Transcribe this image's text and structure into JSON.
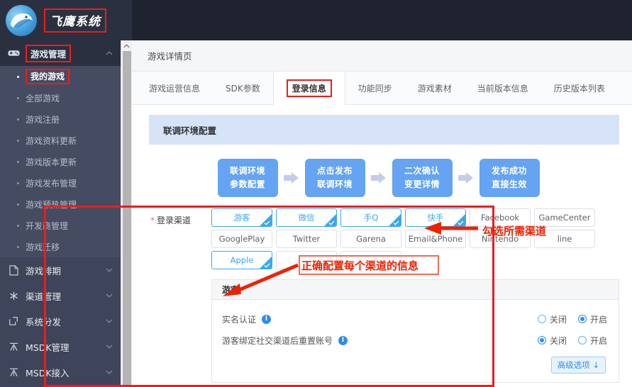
{
  "brand": {
    "name": "飞鹰系统",
    "logo_icon": "eagle-logo-icon"
  },
  "sidebar": {
    "groups": [
      {
        "label": "游戏管理",
        "icon": "gamepad-icon",
        "expanded": true,
        "active": true,
        "items": [
          {
            "label": "我的游戏",
            "active": true
          },
          {
            "label": "全部游戏",
            "active": false
          },
          {
            "label": "游戏注册",
            "active": false
          },
          {
            "label": "游戏资料更新",
            "active": false
          },
          {
            "label": "游戏版本更新",
            "active": false
          },
          {
            "label": "游戏发布管理",
            "active": false
          },
          {
            "label": "游戏预热管理",
            "active": false
          },
          {
            "label": "开发商管理",
            "active": false
          },
          {
            "label": "游戏迁移",
            "active": false
          }
        ]
      },
      {
        "label": "游戏排期",
        "icon": "document-icon",
        "expanded": false,
        "active": false,
        "items": []
      },
      {
        "label": "渠道管理",
        "icon": "asterisk-icon",
        "expanded": false,
        "active": false,
        "items": []
      },
      {
        "label": "系统分发",
        "icon": "external-link-icon",
        "expanded": false,
        "active": false,
        "items": []
      },
      {
        "label": "MSDK管理",
        "icon": "msdk-icon",
        "expanded": false,
        "active": false,
        "items": []
      },
      {
        "label": "MSDK接入",
        "icon": "msdk-icon",
        "expanded": false,
        "active": false,
        "items": []
      }
    ]
  },
  "breadcrumb": {
    "title": "游戏详情页"
  },
  "tabs": [
    {
      "label": "游戏运营信息",
      "active": false
    },
    {
      "label": "SDK参数",
      "active": false
    },
    {
      "label": "登录信息",
      "active": true
    },
    {
      "label": "功能同步",
      "active": false
    },
    {
      "label": "游戏素材",
      "active": false
    },
    {
      "label": "当前版本信息",
      "active": false
    },
    {
      "label": "历史版本列表",
      "active": false
    }
  ],
  "panel": {
    "header": "联调环境配置"
  },
  "flow": {
    "steps": [
      {
        "line1": "联调环境",
        "line2": "参数配置"
      },
      {
        "line1": "点击发布",
        "line2": "联调环境"
      },
      {
        "line1": "二次确认",
        "line2": "变更详情"
      },
      {
        "line1": "发布成功",
        "line2": "直接生效"
      }
    ]
  },
  "channels": {
    "label": "登录渠道",
    "required_mark": "*",
    "items": [
      {
        "label": "游客",
        "selected": true
      },
      {
        "label": "微信",
        "selected": true
      },
      {
        "label": "手Q",
        "selected": true
      },
      {
        "label": "快手",
        "selected": true
      },
      {
        "label": "Facebook",
        "selected": false
      },
      {
        "label": "GameCenter",
        "selected": false
      },
      {
        "label": "GooglePlay",
        "selected": false
      },
      {
        "label": "Twitter",
        "selected": false
      },
      {
        "label": "Garena",
        "selected": false
      },
      {
        "label": "Email&Phone",
        "selected": false
      },
      {
        "label": "Nintendo",
        "selected": false
      },
      {
        "label": "line",
        "selected": false
      },
      {
        "label": "Apple",
        "selected": true
      },
      {
        "label": "",
        "selected": false
      },
      {
        "label": "",
        "selected": false
      }
    ]
  },
  "guest_card": {
    "title": "游客",
    "rows": [
      {
        "label": "实名认证",
        "info_icon": "info-icon",
        "options": [
          {
            "label": "关闭",
            "checked": false
          },
          {
            "label": "开启",
            "checked": true
          }
        ]
      },
      {
        "label": "游客绑定社交渠道后重置账号",
        "info_icon": "info-icon",
        "options": [
          {
            "label": "关闭",
            "checked": true
          },
          {
            "label": "开启",
            "checked": false
          }
        ]
      }
    ],
    "advanced_button": "高级选项 ↓"
  },
  "annotations": [
    {
      "text": "勾选所需渠道",
      "arrow": "left-arrow-icon"
    },
    {
      "text": "正确配置每个渠道的信息",
      "arrow": "up-left-arrow-icon"
    }
  ],
  "colors": {
    "sidebar_bg": "#3e4459",
    "sidebar_dark": "#2b3040",
    "accent_blue": "#3ba7f0",
    "step_blue": "#64a4f2",
    "panel_header": "#d7e3f7",
    "annotation_red": "#ee2200",
    "highlight_red": "#ee1c1c"
  }
}
